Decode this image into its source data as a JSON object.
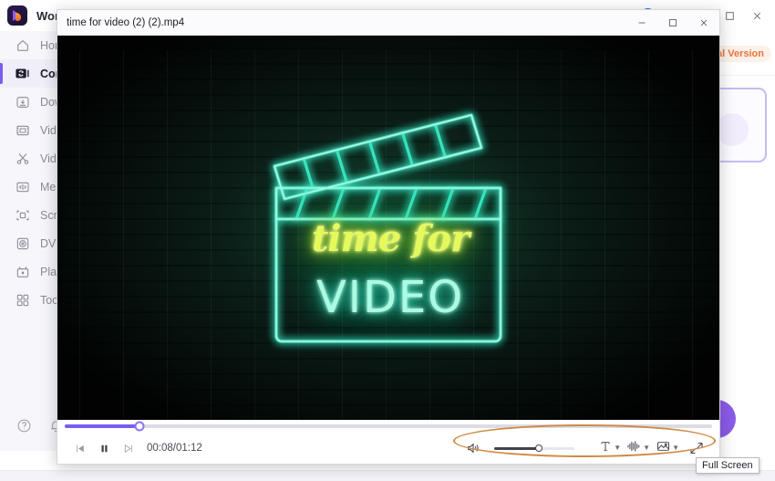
{
  "app": {
    "title": "Wondershare UniConverter",
    "logo_icon": "uniconverter-logo-icon",
    "titlebar_icons": {
      "account_icon": "account-avatar-icon",
      "headset_icon": "headset-support-icon",
      "minimize_icon": "minimize-icon",
      "maximize_icon": "maximize-icon",
      "close_icon": "close-icon"
    }
  },
  "sidebar": {
    "items": [
      {
        "label": "Home",
        "icon": "home-icon",
        "active": false
      },
      {
        "label": "Converter",
        "icon": "converter-icon",
        "active": true
      },
      {
        "label": "Downloader",
        "icon": "download-icon",
        "active": false
      },
      {
        "label": "Video Compressor",
        "icon": "video-compressor-icon",
        "active": false
      },
      {
        "label": "Video Editor",
        "icon": "scissors-icon",
        "active": false
      },
      {
        "label": "Merger",
        "icon": "merger-icon",
        "active": false
      },
      {
        "label": "Screen Recorder",
        "icon": "screen-recorder-icon",
        "active": false
      },
      {
        "label": "DVD Burner",
        "icon": "dvd-icon",
        "active": false
      },
      {
        "label": "Player",
        "icon": "player-icon",
        "active": false
      },
      {
        "label": "Toolbox",
        "icon": "toolbox-icon",
        "active": false
      }
    ],
    "bottom": {
      "help_icon": "help-circle-icon",
      "notification_icon": "bell-icon"
    }
  },
  "right_panel": {
    "trial_label": "Trial Version",
    "add_files_icon": "add-files-icon",
    "fab_icon": "primary-action-icon"
  },
  "player": {
    "window_title": "time for video (2) (2).mp4",
    "window_controls": {
      "minimize_icon": "minimize-icon",
      "maximize_icon": "maximize-icon",
      "close_icon": "close-icon"
    },
    "video": {
      "script_text": "time for",
      "block_text": "VIDEO",
      "scene_icon": "neon-clapperboard-icon",
      "colors": {
        "neon_cyan": "#45e8c6",
        "neon_yellow": "#e6f95a",
        "wall_green": "#147850",
        "background": "#05090a"
      }
    },
    "progress": {
      "percent": 11.6,
      "current_time": "00:08",
      "total_time": "01:12",
      "time_display": "00:08/01:12",
      "fill_color": "#7b5cf0"
    },
    "transport": {
      "previous_icon": "previous-frame-icon",
      "pause_icon": "pause-icon",
      "next_icon": "next-frame-icon"
    },
    "right_controls": {
      "volume_icon": "volume-icon",
      "volume_percent": 55,
      "subtitle_icon": "subtitle-icon",
      "subtitle_caret_icon": "chevron-down-icon",
      "audio_track_icon": "audio-track-icon",
      "audio_caret_icon": "chevron-down-icon",
      "snapshot_icon": "snapshot-icon",
      "snapshot_caret_icon": "chevron-down-icon",
      "fullscreen_icon": "fullscreen-icon"
    }
  },
  "annotation": {
    "highlight_color": "#cf8a43",
    "tooltip_text": "Full Screen"
  }
}
